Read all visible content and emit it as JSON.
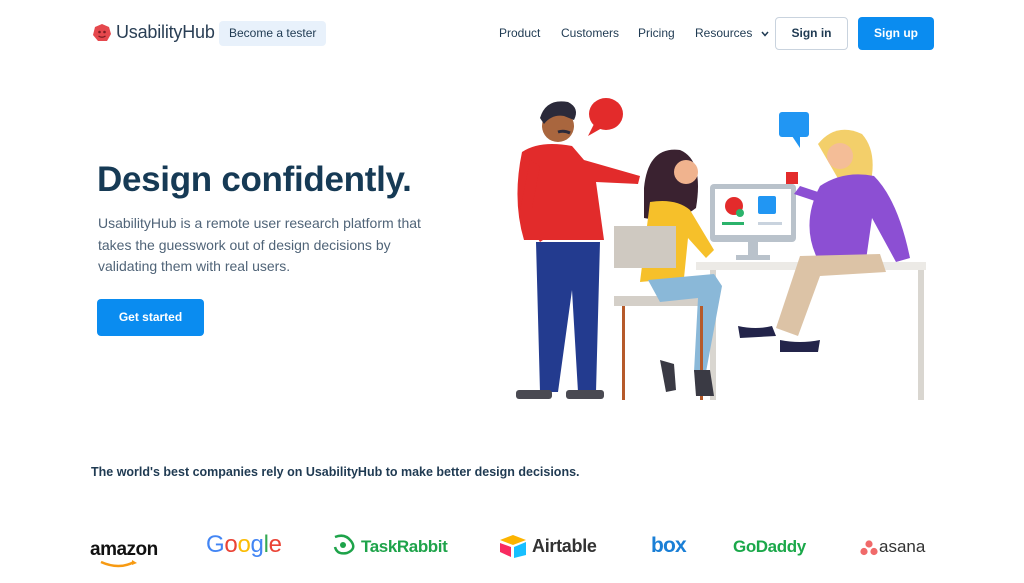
{
  "header": {
    "brand": "UsabilityHub",
    "tester_pill": "Become a tester",
    "nav": [
      {
        "label": "Product"
      },
      {
        "label": "Customers"
      },
      {
        "label": "Pricing"
      },
      {
        "label": "Resources"
      }
    ],
    "signin": "Sign in",
    "signup": "Sign up"
  },
  "hero": {
    "title": "Design confidently.",
    "description": "UsabilityHub is a remote user research platform that takes the guesswork out of design decisions by validating them with real users.",
    "cta": "Get started"
  },
  "trust": {
    "headline": "The world's best companies rely on UsabilityHub to make better design decisions.",
    "logos": [
      "amazon",
      "Google",
      "TaskRabbit",
      "Airtable",
      "box",
      "GoDaddy",
      "asana"
    ]
  },
  "colors": {
    "primary": "#0a8cf0",
    "heading": "#163a55",
    "text": "#506478",
    "pill_bg": "#e8f1fb"
  }
}
